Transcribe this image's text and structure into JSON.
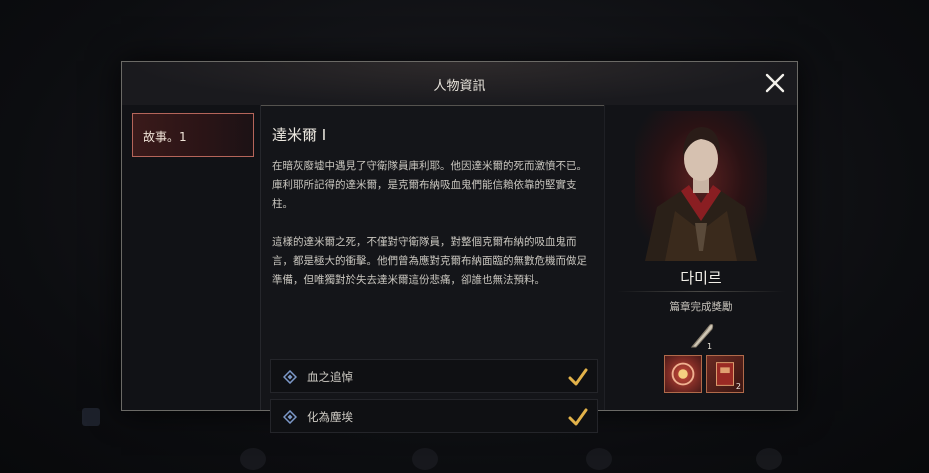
{
  "dialog": {
    "title": "人物資訊",
    "close_icon": "close-icon"
  },
  "chapter_tabs": [
    {
      "label": "故事。1",
      "selected": true
    }
  ],
  "story": {
    "title": "達米爾 I",
    "paragraphs": [
      "在暗灰廢墟中遇見了守衛隊員庫利耶。他因達米爾的死而激憤不已。庫利耶所記得的達米爾，是克爾布納吸血鬼們能信賴依靠的堅實支柱。",
      "這樣的達米爾之死，不僅對守衛隊員，對整個克爾布納的吸血鬼而言，都是極大的衝擊。他們曾為應對克爾布納面臨的無數危機而做足準備，但唯獨對於失去達米爾這份悲痛，卻誰也無法預料。"
    ],
    "objectives": [
      {
        "label": "血之追悼",
        "completed": true,
        "icon": "diamond-icon"
      },
      {
        "label": "化為塵埃",
        "completed": true,
        "icon": "diamond-icon"
      }
    ]
  },
  "character": {
    "name": "다미르",
    "reward_label": "篇章完成獎勵",
    "reward_feather_count": "1",
    "reward_items": [
      {
        "icon": "red-orb-icon",
        "count": ""
      },
      {
        "icon": "red-book-icon",
        "count": "2"
      }
    ]
  },
  "colors": {
    "accent": "#b5655a",
    "check": "#e2b24a",
    "panel": "#141519"
  }
}
